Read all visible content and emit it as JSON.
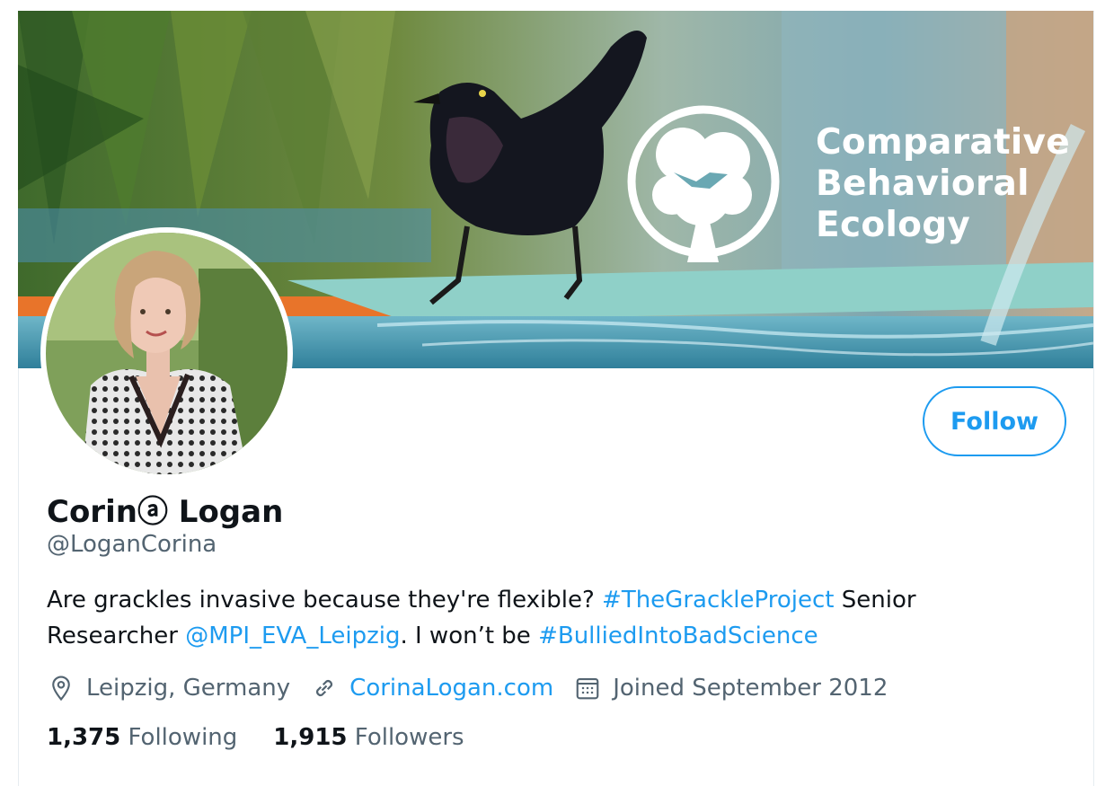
{
  "profile": {
    "name": "Corinⓐ Logan",
    "handle": "@LoganCorina",
    "follow_label": "Follow",
    "bio": {
      "part1": "Are grackles invasive because they're flexible? ",
      "tag1": "#TheGrackleProject",
      "part2": " Senior Researcher ",
      "mention": "@MPI_EVA_Leipzig",
      "part3": ". I won’t be ",
      "tag2": "#BulliedIntoBadScience"
    },
    "location": "Leipzig, Germany",
    "website": "CorinaLogan.com",
    "joined": "Joined September 2012",
    "following_count": "1,375",
    "following_label": "Following",
    "followers_count": "1,915",
    "followers_label": "Followers"
  },
  "banner": {
    "brand_line1": "Comparative",
    "brand_line2": "Behavioral",
    "brand_line3": "Ecology"
  },
  "icons": {
    "location": "location-pin-icon",
    "link": "link-icon",
    "calendar": "calendar-icon"
  },
  "colors": {
    "accent": "#1d9bf0",
    "secondary_text": "#536471",
    "primary_text": "#0f1419"
  }
}
